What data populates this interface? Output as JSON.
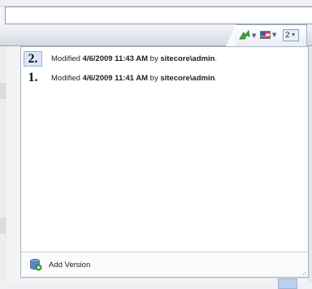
{
  "version_selector": {
    "current_version": "2",
    "language_flag": "us-flag-icon",
    "workflow_icon": "workflow-arrow-icon"
  },
  "versions": [
    {
      "number": "2.",
      "prefix": "Modified",
      "date": "4/6/2009 11:43 AM",
      "by": "by",
      "user": "sitecore\\admin",
      "suffix": ".",
      "selected": true
    },
    {
      "number": "1.",
      "prefix": "Modified",
      "date": "4/6/2009 11:41 AM",
      "by": "by",
      "user": "sitecore\\admin",
      "suffix": ".",
      "selected": false
    }
  ],
  "footer": {
    "add_version_label": "Add Version",
    "add_version_icon": "database-add-icon"
  },
  "colors": {
    "selected_highlight": "#dbe7f6",
    "panel_border": "#a9b3c0",
    "chip_border": "#8aa0bd"
  }
}
